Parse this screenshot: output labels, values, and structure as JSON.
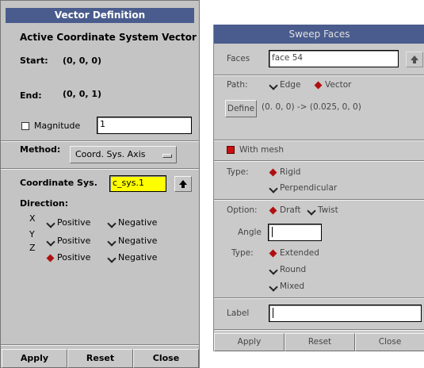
{
  "vector_dialog": {
    "title": "Vector Definition",
    "heading": "Active Coordinate System Vector",
    "start_label": "Start:",
    "start_value": "(0, 0, 0)",
    "end_label": "End:",
    "end_value": "(0, 0, 1)",
    "magnitude_label": "Magnitude",
    "magnitude_value": "1",
    "method_label": "Method:",
    "method_value": "Coord. Sys. Axis",
    "coord_sys_label": "Coordinate Sys.",
    "coord_sys_value": "c_sys.1",
    "direction_label": "Direction:",
    "axes": [
      {
        "axis": "X",
        "positive": "Positive",
        "negative": "Negative",
        "selected": "negative"
      },
      {
        "axis": "Y",
        "positive": "Positive",
        "negative": "Negative",
        "selected": "negative"
      },
      {
        "axis": "Z",
        "positive": "Positive",
        "negative": "Negative",
        "selected": "positive"
      }
    ],
    "apply_label": "Apply",
    "reset_label": "Reset",
    "close_label": "Close"
  },
  "sweep_dialog": {
    "title": "Sweep Faces",
    "faces_label": "Faces",
    "faces_value": "face 54",
    "path_label": "Path:",
    "path_edge": "Edge",
    "path_vector": "Vector",
    "path_selected": "vector",
    "define_label": "Define",
    "define_value": "(0. 0, 0) -> (0.025, 0, 0)",
    "with_mesh_label": "With mesh",
    "type_label": "Type:",
    "type_rigid": "Rigid",
    "type_perpendicular": "Perpendicular",
    "type_selected": "rigid",
    "option_label": "Option:",
    "option_draft": "Draft",
    "option_twist": "Twist",
    "option_selected": "draft",
    "angle_label": "Angle",
    "angle_value": "",
    "type2_label": "Type:",
    "type2_extended": "Extended",
    "type2_round": "Round",
    "type2_mixed": "Mixed",
    "type2_selected": "extended",
    "label_label": "Label",
    "label_value": "",
    "apply_label": "Apply",
    "reset_label": "Reset",
    "close_label": "Close"
  },
  "colors": {
    "titlebar": "#4a5c8d",
    "panel": "#c4c4c4",
    "highlight_field": "#ffff00",
    "selected_radio": "#b01010"
  }
}
